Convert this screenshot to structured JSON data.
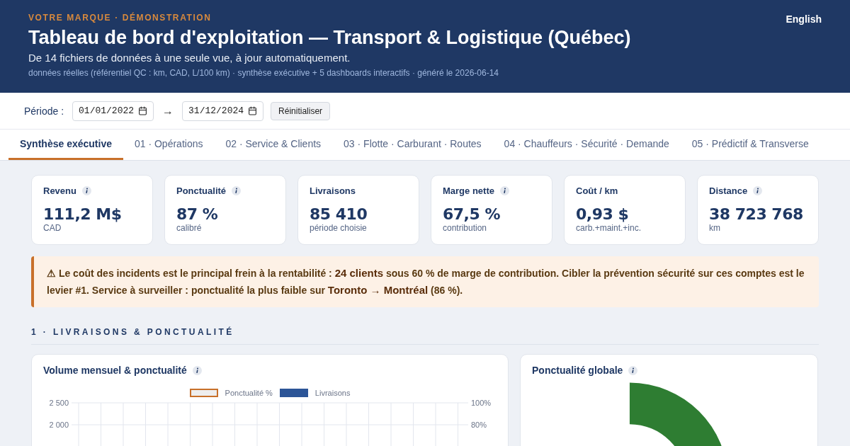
{
  "header": {
    "eyebrow": "VOTRE MARQUE · DÉMONSTRATION",
    "title": "Tableau de bord d'exploitation — Transport & Logistique (Québec)",
    "subtitle": "De 14 fichiers de données à une seule vue, à jour automatiquement.",
    "meta": "données réelles (référentiel QC : km, CAD, L/100 km) · synthèse exécutive + 5 dashboards interactifs · généré le 2026-06-14",
    "language_link": "English"
  },
  "period": {
    "label": "Période :",
    "start": "01/01/2022",
    "arrow": "→",
    "end": "31/12/2024",
    "reset_button": "Réinitialiser"
  },
  "tabs": [
    {
      "label": "Synthèse exécutive",
      "selected": true
    },
    {
      "label": "01 · Opérations",
      "selected": false
    },
    {
      "label": "02 · Service & Clients",
      "selected": false
    },
    {
      "label": "03 · Flotte · Carburant · Routes",
      "selected": false
    },
    {
      "label": "04 · Chauffeurs · Sécurité · Demande",
      "selected": false
    },
    {
      "label": "05 · Prédictif & Transverse",
      "selected": false
    }
  ],
  "kpis": [
    {
      "label": "Revenu",
      "info": true,
      "value": "111,2 M$",
      "note": "CAD"
    },
    {
      "label": "Ponctualité",
      "info": true,
      "value": "87 %",
      "note": "calibré"
    },
    {
      "label": "Livraisons",
      "info": false,
      "value": "85 410",
      "note": "période choisie"
    },
    {
      "label": "Marge nette",
      "info": true,
      "value": "67,5 %",
      "note": "contribution"
    },
    {
      "label": "Coût / km",
      "info": false,
      "value": "0,93 $",
      "note": "carb.+maint.+inc."
    },
    {
      "label": "Distance",
      "info": true,
      "value": "38 723 768",
      "note": "km"
    }
  ],
  "alert": "⚠ Le coût des incidents est le principal frein à la rentabilité : **24 clients** sous 60 % de marge de contribution. Cibler la prévention sécurité sur ces comptes est le levier #1. Service à surveiller : ponctualité la plus faible sur **Toronto → Montréal** (86 %).",
  "section_title": "1 · LIVRAISONS & PONCTUALITÉ",
  "volume_card": {
    "title": "Volume mensuel & ponctualité",
    "legend": [
      {
        "label": "Ponctualité %",
        "kind": "outline",
        "color": "#c8702a"
      },
      {
        "label": "Livraisons",
        "kind": "filled",
        "color": "#2c5597"
      }
    ],
    "left_ticks": [
      "2 500",
      "2 000"
    ],
    "right_ticks": [
      "100%",
      "80%"
    ]
  },
  "punctuality_card": {
    "title": "Ponctualité globale"
  }
}
